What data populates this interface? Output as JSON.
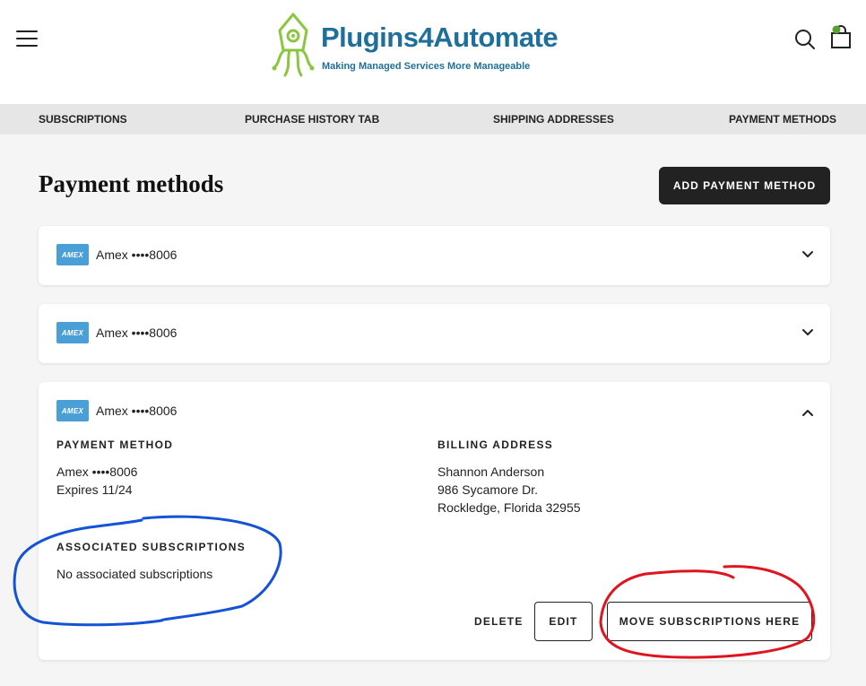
{
  "brand": {
    "name": "Plugins4Automate",
    "tagline": "Making Managed Services More Manageable",
    "logo_color_green": "#8cc63f",
    "logo_color_blue": "#1f6f9b"
  },
  "header": {
    "menu_icon": "hamburger-icon",
    "search_icon": "search-icon",
    "cart_icon": "shopping-bag-icon"
  },
  "nav": {
    "items": [
      {
        "label": "SUBSCRIPTIONS"
      },
      {
        "label": "PURCHASE HISTORY TAB"
      },
      {
        "label": "SHIPPING ADDRESSES"
      },
      {
        "label": "PAYMENT METHODS"
      }
    ]
  },
  "page": {
    "title": "Payment methods",
    "add_button": "ADD PAYMENT METHOD"
  },
  "cards": [
    {
      "brand_badge": "AMEX",
      "label": "Amex ••••8006",
      "expanded": false
    },
    {
      "brand_badge": "AMEX",
      "label": "Amex ••••8006",
      "expanded": false
    },
    {
      "brand_badge": "AMEX",
      "label": "Amex ••••8006",
      "expanded": true
    }
  ],
  "details": {
    "payment_method_heading": "PAYMENT METHOD",
    "payment_method_line1": "Amex ••••8006",
    "payment_method_line2": "Expires 11/24",
    "billing_heading": "BILLING ADDRESS",
    "billing_name": "Shannon Anderson",
    "billing_street": "986 Sycamore Dr.",
    "billing_city": "Rockledge, Florida 32955",
    "associated_heading": "ASSOCIATED SUBSCRIPTIONS",
    "associated_text": "No associated subscriptions",
    "delete_label": "DELETE",
    "edit_label": "EDIT",
    "move_label": "MOVE SUBSCRIPTIONS HERE"
  },
  "annotations": {
    "blue_circle_color": "#1452d6",
    "red_circle_color": "#e0141e"
  }
}
